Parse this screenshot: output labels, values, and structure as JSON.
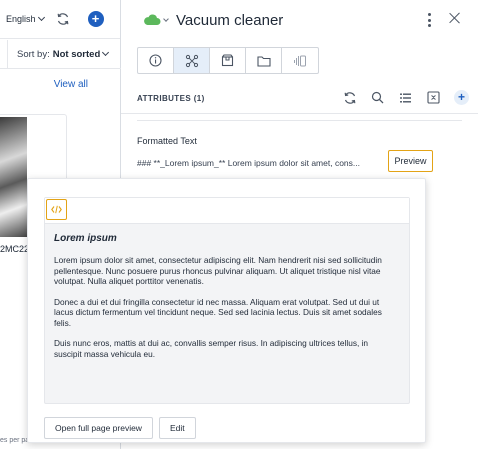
{
  "left_panel": {
    "language": "English",
    "sort_label": "Sort by:",
    "sort_value": "Not sorted",
    "view_all": "View all",
    "card_code": "2MC22",
    "footer_text": "es per pa"
  },
  "header": {
    "title": "Vacuum cleaner",
    "status_color": "#5cb85c"
  },
  "tabs": [
    {
      "icon": "info-icon"
    },
    {
      "icon": "attributes-icon",
      "active": true
    },
    {
      "icon": "package-icon"
    },
    {
      "icon": "folder-icon"
    },
    {
      "icon": "audio-icon"
    }
  ],
  "attributes": {
    "header": "ATTRIBUTES (1)",
    "item_label": "Formatted Text",
    "item_value": "### **_Lorem ipsum_** Lorem ipsum dolor sit amet, cons...",
    "preview_button": "Preview"
  },
  "popover": {
    "heading": "Lorem ipsum",
    "paragraphs": [
      "Lorem ipsum dolor sit amet, consectetur adipiscing elit. Nam hendrerit nisi sed sollicitudin pellentesque. Nunc posuere purus rhoncus pulvinar aliquam. Ut aliquet tristique nisl vitae volutpat. Nulla aliquet porttitor venenatis.",
      "Donec a dui et dui fringilla consectetur id nec massa. Aliquam erat volutpat. Sed ut dui ut lacus dictum fermentum vel tincidunt neque. Sed sed lacinia lectus. Duis sit amet sodales felis.",
      "Duis nunc eros, mattis at dui ac, convallis semper risus. In adipiscing ultrices tellus, in suscipit massa vehicula eu."
    ],
    "open_full_button": "Open full page preview",
    "edit_button": "Edit"
  },
  "colors": {
    "accent": "#1f5fbf",
    "focus": "#e3a316"
  }
}
